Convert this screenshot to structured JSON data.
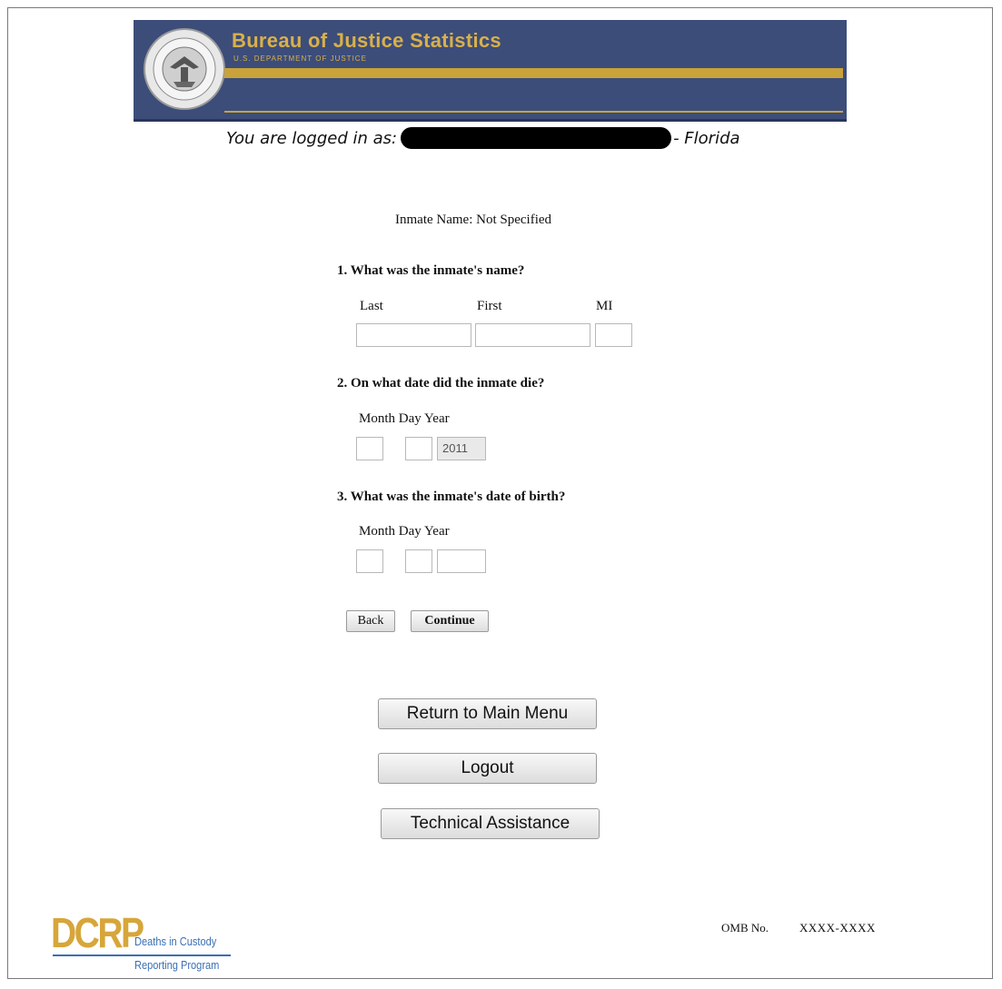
{
  "banner": {
    "title": "Bureau of Justice Statistics",
    "subtitle": "U.S. DEPARTMENT OF JUSTICE",
    "colors": {
      "background": "#3c4d7a",
      "gold": "#c9a23a"
    }
  },
  "session": {
    "logged_in_label": "You are logged in as:",
    "state_suffix": "- Florida"
  },
  "inmate_header": "Inmate Name: Not Specified",
  "form": {
    "q1": {
      "question": "1. What was the inmate's name?",
      "labels": {
        "last": "Last",
        "first": "First",
        "mi": "MI"
      },
      "values": {
        "last": "",
        "first": "",
        "mi": ""
      }
    },
    "q2": {
      "question": "2. On what date did the inmate die?",
      "labels": {
        "month": "Month",
        "day": "Day",
        "year": "Year"
      },
      "values": {
        "month": "",
        "day": "",
        "year": "2011"
      }
    },
    "q3": {
      "question": "3. What was the inmate's date of birth?",
      "labels": {
        "month": "Month",
        "day": "Day",
        "year": "Year"
      },
      "values": {
        "month": "",
        "day": "",
        "year": ""
      }
    },
    "buttons": {
      "back": "Back",
      "continue": "Continue"
    }
  },
  "nav_buttons": {
    "main_menu": "Return to Main Menu",
    "logout": "Logout",
    "tech_assist": "Technical Assistance"
  },
  "footer": {
    "logo": {
      "acronym": "DCRP",
      "line1": "Deaths in Custody",
      "line2": "Reporting Program"
    },
    "omb_label": "OMB No.",
    "omb_value": "XXXX-XXXX"
  }
}
